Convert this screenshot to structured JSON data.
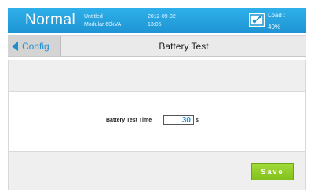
{
  "header": {
    "status": "Normal",
    "project_name": "Untitled",
    "model": "Modular 60kVA",
    "date": "2012-09-02",
    "time": "13:05",
    "load_label": "Load :",
    "load_value": "40%",
    "icon": "ups-diagram-icon"
  },
  "nav": {
    "back_label": "Config",
    "title": "Battery Test"
  },
  "form": {
    "field_label": "Battery Test Time",
    "field_value": "30",
    "unit": "s"
  },
  "actions": {
    "save_label": "Save"
  },
  "colors": {
    "header_blue": "#1e94d4",
    "accent_blue": "#1d8fd1",
    "save_green": "#8cc720"
  }
}
